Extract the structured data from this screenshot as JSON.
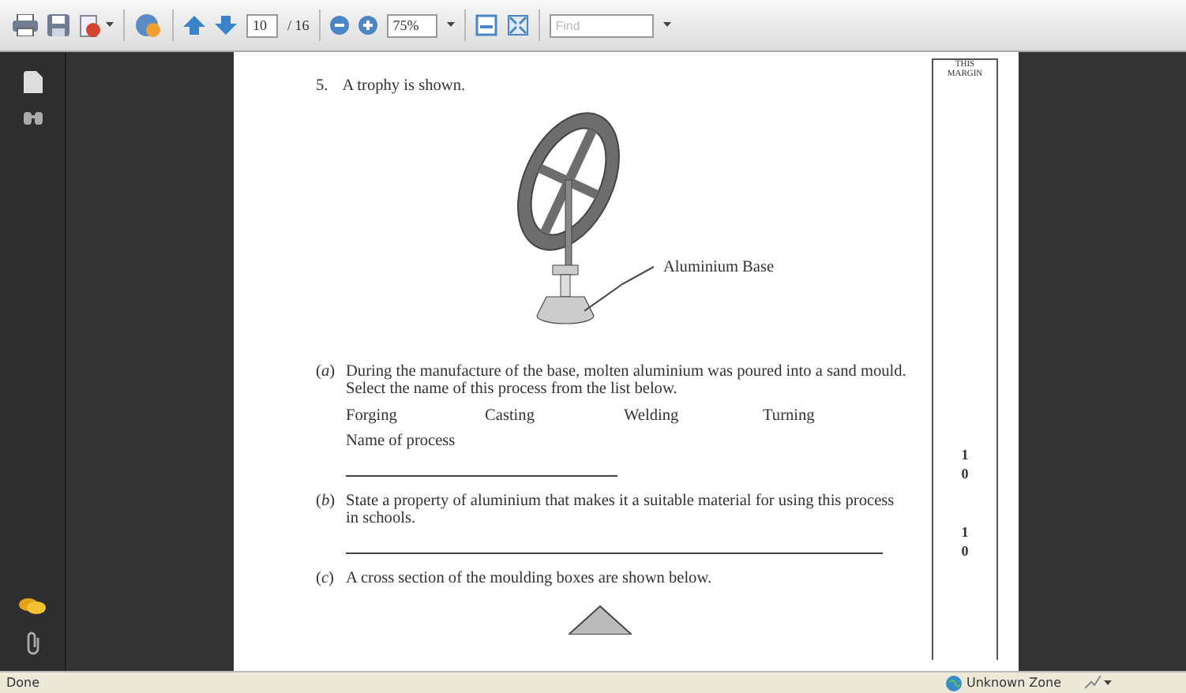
{
  "toolbar": {
    "page_field": "10",
    "page_total": "/ 16",
    "zoom_field": "75%",
    "find": {
      "placeholder": "Find"
    }
  },
  "document": {
    "margin_header": [
      "THIS",
      "MARGIN"
    ],
    "question": {
      "number": "5.",
      "text": "A trophy is shown.",
      "figure_label": "Aluminium Base",
      "parts": [
        {
          "label": "(*a*)",
          "text": "During the manufacture of the base, molten aluminium was poured into a sand mould.  Select the name of this process from the list below.",
          "options": [
            "Forging",
            "Casting",
            "Welding",
            "Turning"
          ],
          "answer_label": "Name of process",
          "kind": "short_answer",
          "marks": [
            "1",
            "0"
          ]
        },
        {
          "label": "(*b*)",
          "text": "State a property of aluminium that makes it a suitable material for using this process in schools.",
          "kind": "long_answer",
          "marks": [
            "1",
            "0"
          ]
        },
        {
          "label": "(*c*)",
          "text": "A cross section of the moulding boxes are shown below."
        }
      ]
    }
  },
  "status_bar": {
    "status": "Done",
    "zone": "Unknown Zone"
  }
}
